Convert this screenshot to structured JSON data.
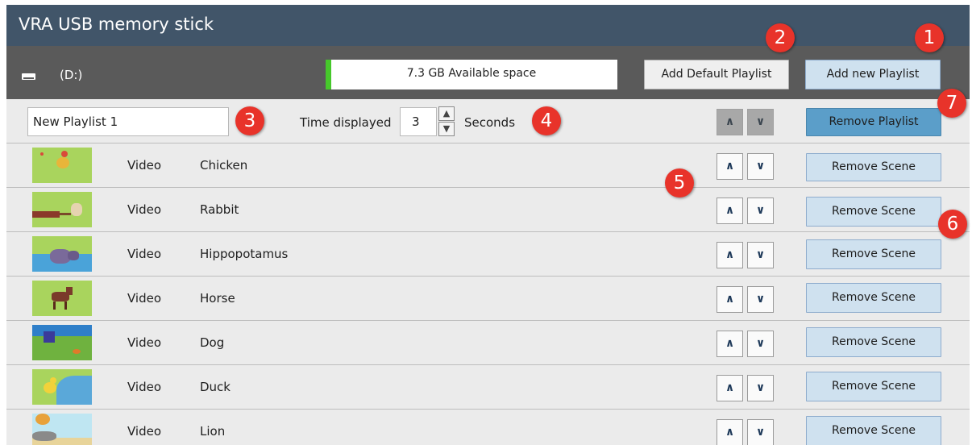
{
  "window": {
    "title": "VRA USB memory stick"
  },
  "drive": {
    "icon": "drive-icon",
    "label": "(D:)",
    "available_label": "7.3 GB Available space",
    "used_fraction": 0.02,
    "buttons": {
      "add_default": "Add Default Playlist",
      "add_new": "Add new Playlist"
    }
  },
  "playlist": {
    "name": "New Playlist 1",
    "time_label": "Time displayed",
    "time_value": "3",
    "seconds_label": "Seconds",
    "remove_label": "Remove Playlist"
  },
  "scenes": [
    {
      "type": "Video",
      "name": "Chicken",
      "remove_label": "Remove Scene"
    },
    {
      "type": "Video",
      "name": "Rabbit",
      "remove_label": "Remove Scene"
    },
    {
      "type": "Video",
      "name": "Hippopotamus",
      "remove_label": "Remove Scene"
    },
    {
      "type": "Video",
      "name": "Horse",
      "remove_label": "Remove Scene"
    },
    {
      "type": "Video",
      "name": "Dog",
      "remove_label": "Remove Scene"
    },
    {
      "type": "Video",
      "name": "Duck",
      "remove_label": "Remove Scene"
    },
    {
      "type": "Video",
      "name": "Lion",
      "remove_label": "Remove Scene"
    }
  ],
  "callouts": [
    "1",
    "2",
    "3",
    "4",
    "5",
    "6",
    "7"
  ],
  "colors": {
    "titlebar": "#415569",
    "drivebar": "#5a5a5a",
    "button": "#cfe1ef",
    "button_active": "#5b9ec9",
    "space_fill": "#46c82b",
    "callout": "#e8332a"
  }
}
